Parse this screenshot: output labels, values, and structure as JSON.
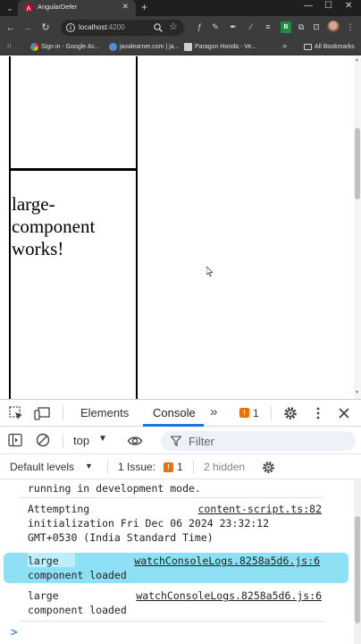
{
  "browser": {
    "tab_title": "AngularDefer",
    "url_host": "localhost",
    "url_port": ":4200",
    "bookmarks": [
      {
        "label": "Sign in - Google Ac..."
      },
      {
        "label": "javalearner.com | ja..."
      },
      {
        "label": "Paragon Honda - Ve..."
      }
    ],
    "bookmarks_overflow": "»",
    "all_bookmarks": "All Bookmarks",
    "ext_badge": "B"
  },
  "page": {
    "component_text": "large-component works!"
  },
  "devtools": {
    "tabs": [
      {
        "label": "Elements"
      },
      {
        "label": "Console"
      }
    ],
    "more_tabs": "»",
    "issues_count": "1",
    "context": "top",
    "filter_placeholder": "Filter",
    "levels_label": "Default levels",
    "issue_label": "1 Issue:",
    "issue_count": "1",
    "hidden_label": "2 hidden",
    "logs": [
      {
        "message": "running in development mode.",
        "source": ""
      },
      {
        "message": "Attempting\ninitialization Fri Dec 06 2024 23:32:12\nGMT+0530 (India Standard Time)",
        "source": "content-script.ts:82"
      },
      {
        "message": "large\ncomponent loaded",
        "source": "watchConsoleLogs.8258a5d6.js:6"
      },
      {
        "message": "large\ncomponent loaded",
        "source": "watchConsoleLogs.8258a5d6.js:6"
      }
    ],
    "prompt_symbol": ">"
  },
  "colors": {
    "chrome_dark": "#1f1f1f",
    "chrome_toolbar": "#3c3c3c",
    "devtools_accent": "#1a73e8",
    "issue_orange": "#e8710a",
    "log_highlight": "#8ee0f5"
  }
}
